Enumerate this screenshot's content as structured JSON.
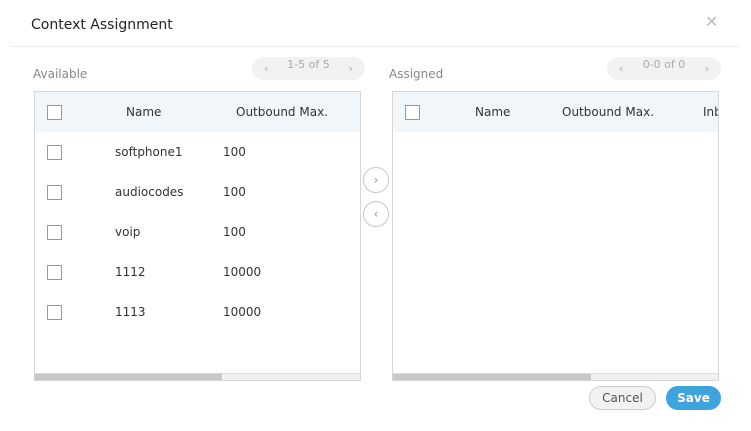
{
  "dialog": {
    "title": "Context Assignment",
    "close_icon": "close-icon"
  },
  "available": {
    "label": "Available",
    "pager": "1-5 of 5",
    "prev": "‹",
    "next": "›",
    "columns": [
      "Name",
      "Outbound Max."
    ],
    "rows": [
      {
        "name": "softphone1",
        "outbound": "100"
      },
      {
        "name": "audiocodes",
        "outbound": "100"
      },
      {
        "name": "voip",
        "outbound": "100"
      },
      {
        "name": "1112",
        "outbound": "10000"
      },
      {
        "name": "1113",
        "outbound": "10000"
      }
    ]
  },
  "assigned": {
    "label": "Assigned",
    "pager": "0-0 of 0",
    "prev": "‹",
    "next": "›",
    "columns": [
      "Name",
      "Outbound Max.",
      "Inbound Max."
    ]
  },
  "transfer": {
    "move_right": "›",
    "move_left": "‹"
  },
  "footer": {
    "cancel": "Cancel",
    "save": "Save"
  }
}
